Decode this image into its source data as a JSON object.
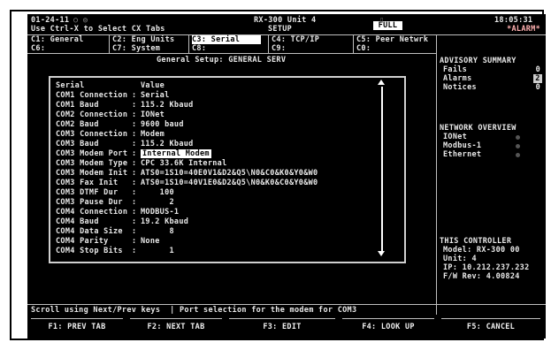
{
  "header": {
    "date": "01-24-11",
    "title_line1": "RX-300 Unit 4",
    "title_line2": "SETUP",
    "time": "18:05:31",
    "hint": "Use Ctrl-X to Select CX Tabs",
    "full": "FULL",
    "alarm": "*ALARM*"
  },
  "tabs": [
    {
      "label": "C1: General"
    },
    {
      "label": "C2: Eng Units"
    },
    {
      "label": "C3: Serial"
    },
    {
      "label": "C4: TCP/IP"
    },
    {
      "label": "C5: Peer Netwrk"
    },
    {
      "label": "C6:"
    },
    {
      "label": "C7: System"
    },
    {
      "label": "C8:"
    },
    {
      "label": "C9:"
    },
    {
      "label": "C0:"
    }
  ],
  "setup_title": "General Setup: GENERAL SERV",
  "table": {
    "col1": "Serial",
    "col2": "Value",
    "rows": [
      {
        "name": "COM1 Connection",
        "value": "Serial"
      },
      {
        "name": "COM1 Baud      ",
        "value": "115.2 Kbaud"
      },
      {
        "name": "COM2 Connection",
        "value": "IONet"
      },
      {
        "name": "COM2 Baud      ",
        "value": "9600 baud"
      },
      {
        "name": "COM3 Connection",
        "value": "Modem"
      },
      {
        "name": "COM3 Baud      ",
        "value": "115.2 Kbaud"
      },
      {
        "name": "COM3 Modem Port",
        "value": "Internal Modem"
      },
      {
        "name": "COM3 Modem Type",
        "value": "CPC 33.6K Internal"
      },
      {
        "name": "COM3 Modem Init",
        "value": "ATS0=1S10=40E0V1&D2&Q5\\N0&C0&K0&Y0&W0"
      },
      {
        "name": "COM3 Fax Init  ",
        "value": "ATS0=1S10=40V1E0&D2&Q5\\N0&K0&C0&Y0&W0"
      },
      {
        "name": "COM3 DTMF Dur  ",
        "value": "    100"
      },
      {
        "name": "COM3 Pause Dur ",
        "value": "      2"
      },
      {
        "name": "COM4 Connection",
        "value": "MODBUS-1"
      },
      {
        "name": "COM4 Baud      ",
        "value": "19.2 Kbaud"
      },
      {
        "name": "COM4 Data Size ",
        "value": "      8"
      },
      {
        "name": "COM4 Parity    ",
        "value": "None"
      },
      {
        "name": "COM4 Stop Bits ",
        "value": "      1"
      }
    ]
  },
  "advisory": {
    "title": "ADVISORY SUMMARY",
    "fails_label": "Fails",
    "fails_value": "0",
    "alarms_label": "Alarms",
    "alarms_value": "2",
    "notices_label": "Notices",
    "notices_value": "0"
  },
  "network": {
    "title": "NETWORK OVERVIEW",
    "items": [
      {
        "label": "IONet"
      },
      {
        "label": "Modbus-1"
      },
      {
        "label": "Ethernet"
      }
    ]
  },
  "controller": {
    "title": "THIS CONTROLLER",
    "model": "Model: RX-300  00",
    "unit": "Unit: 4",
    "ip": "IP: 10.212.237.232",
    "fw": "F/W Rev: 4.00824"
  },
  "status_line": "Scroll using Next/Prev keys  | Port selection for the modem for COM3",
  "fkeys": [
    {
      "label": "F1: PREV TAB"
    },
    {
      "label": "F2: NEXT TAB"
    },
    {
      "label": "F3: EDIT"
    },
    {
      "label": "F4: LOOK UP"
    },
    {
      "label": "F5: CANCEL"
    }
  ]
}
